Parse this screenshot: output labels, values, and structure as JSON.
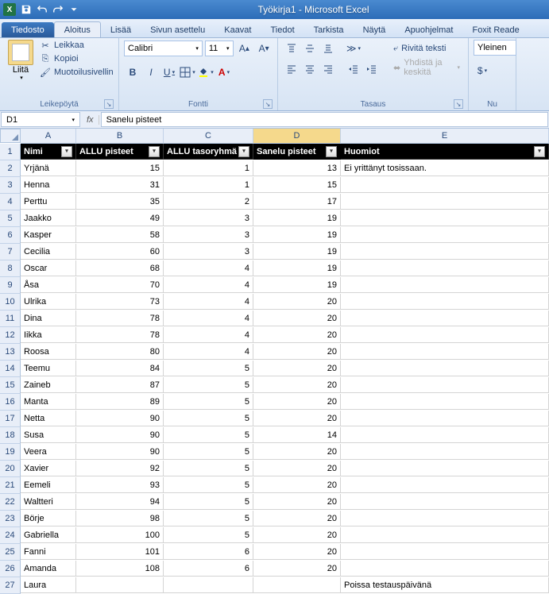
{
  "titlebar": {
    "text": "Työkirja1 - Microsoft Excel"
  },
  "tabs": {
    "file": "Tiedosto",
    "home": "Aloitus",
    "insert": "Lisää",
    "page_layout": "Sivun asettelu",
    "formulas": "Kaavat",
    "data": "Tiedot",
    "review": "Tarkista",
    "view": "Näytä",
    "addins": "Apuohjelmat",
    "foxit": "Foxit Reade"
  },
  "ribbon": {
    "clipboard": {
      "label": "Leikepöytä",
      "paste": "Liitä",
      "cut": "Leikkaa",
      "copy": "Kopioi",
      "format_painter": "Muotoilusivellin"
    },
    "font": {
      "label": "Fontti",
      "name": "Calibri",
      "size": "11"
    },
    "alignment": {
      "label": "Tasaus",
      "wrap": "Rivitä teksti",
      "merge": "Yhdistä ja keskitä"
    },
    "number": {
      "label": "Nu",
      "format": "Yleinen"
    }
  },
  "namebox": "D1",
  "formula": "Sanelu pisteet",
  "columns": [
    "A",
    "B",
    "C",
    "D",
    "E"
  ],
  "headers": {
    "a": "Nimi",
    "b": "ALLU pisteet",
    "c": "ALLU tasoryhmä",
    "d": "Sanelu pisteet",
    "e": "Huomiot"
  },
  "rows": [
    {
      "n": 2,
      "a": "Yrjänä",
      "b": 15,
      "c": 1,
      "d": 13,
      "e": "Ei yrittänyt tosissaan."
    },
    {
      "n": 3,
      "a": "Henna",
      "b": 31,
      "c": 1,
      "d": 15,
      "e": ""
    },
    {
      "n": 4,
      "a": "Perttu",
      "b": 35,
      "c": 2,
      "d": 17,
      "e": ""
    },
    {
      "n": 5,
      "a": "Jaakko",
      "b": 49,
      "c": 3,
      "d": 19,
      "e": ""
    },
    {
      "n": 6,
      "a": "Kasper",
      "b": 58,
      "c": 3,
      "d": 19,
      "e": ""
    },
    {
      "n": 7,
      "a": "Cecilia",
      "b": 60,
      "c": 3,
      "d": 19,
      "e": ""
    },
    {
      "n": 8,
      "a": "Oscar",
      "b": 68,
      "c": 4,
      "d": 19,
      "e": ""
    },
    {
      "n": 9,
      "a": "Åsa",
      "b": 70,
      "c": 4,
      "d": 19,
      "e": ""
    },
    {
      "n": 10,
      "a": "Ulrika",
      "b": 73,
      "c": 4,
      "d": 20,
      "e": ""
    },
    {
      "n": 11,
      "a": "Dina",
      "b": 78,
      "c": 4,
      "d": 20,
      "e": ""
    },
    {
      "n": 12,
      "a": "Iikka",
      "b": 78,
      "c": 4,
      "d": 20,
      "e": ""
    },
    {
      "n": 13,
      "a": "Roosa",
      "b": 80,
      "c": 4,
      "d": 20,
      "e": ""
    },
    {
      "n": 14,
      "a": "Teemu",
      "b": 84,
      "c": 5,
      "d": 20,
      "e": ""
    },
    {
      "n": 15,
      "a": "Zaineb",
      "b": 87,
      "c": 5,
      "d": 20,
      "e": ""
    },
    {
      "n": 16,
      "a": "Manta",
      "b": 89,
      "c": 5,
      "d": 20,
      "e": ""
    },
    {
      "n": 17,
      "a": "Netta",
      "b": 90,
      "c": 5,
      "d": 20,
      "e": ""
    },
    {
      "n": 18,
      "a": "Susa",
      "b": 90,
      "c": 5,
      "d": 14,
      "e": ""
    },
    {
      "n": 19,
      "a": "Veera",
      "b": 90,
      "c": 5,
      "d": 20,
      "e": ""
    },
    {
      "n": 20,
      "a": "Xavier",
      "b": 92,
      "c": 5,
      "d": 20,
      "e": ""
    },
    {
      "n": 21,
      "a": "Eemeli",
      "b": 93,
      "c": 5,
      "d": 20,
      "e": ""
    },
    {
      "n": 22,
      "a": "Waltteri",
      "b": 94,
      "c": 5,
      "d": 20,
      "e": ""
    },
    {
      "n": 23,
      "a": "Börje",
      "b": 98,
      "c": 5,
      "d": 20,
      "e": ""
    },
    {
      "n": 24,
      "a": "Gabriella",
      "b": 100,
      "c": 5,
      "d": 20,
      "e": ""
    },
    {
      "n": 25,
      "a": "Fanni",
      "b": 101,
      "c": 6,
      "d": 20,
      "e": ""
    },
    {
      "n": 26,
      "a": "Amanda",
      "b": 108,
      "c": 6,
      "d": 20,
      "e": ""
    },
    {
      "n": 27,
      "a": "Laura",
      "b": "",
      "c": "",
      "d": "",
      "e": "Poissa testauspäivänä"
    }
  ]
}
